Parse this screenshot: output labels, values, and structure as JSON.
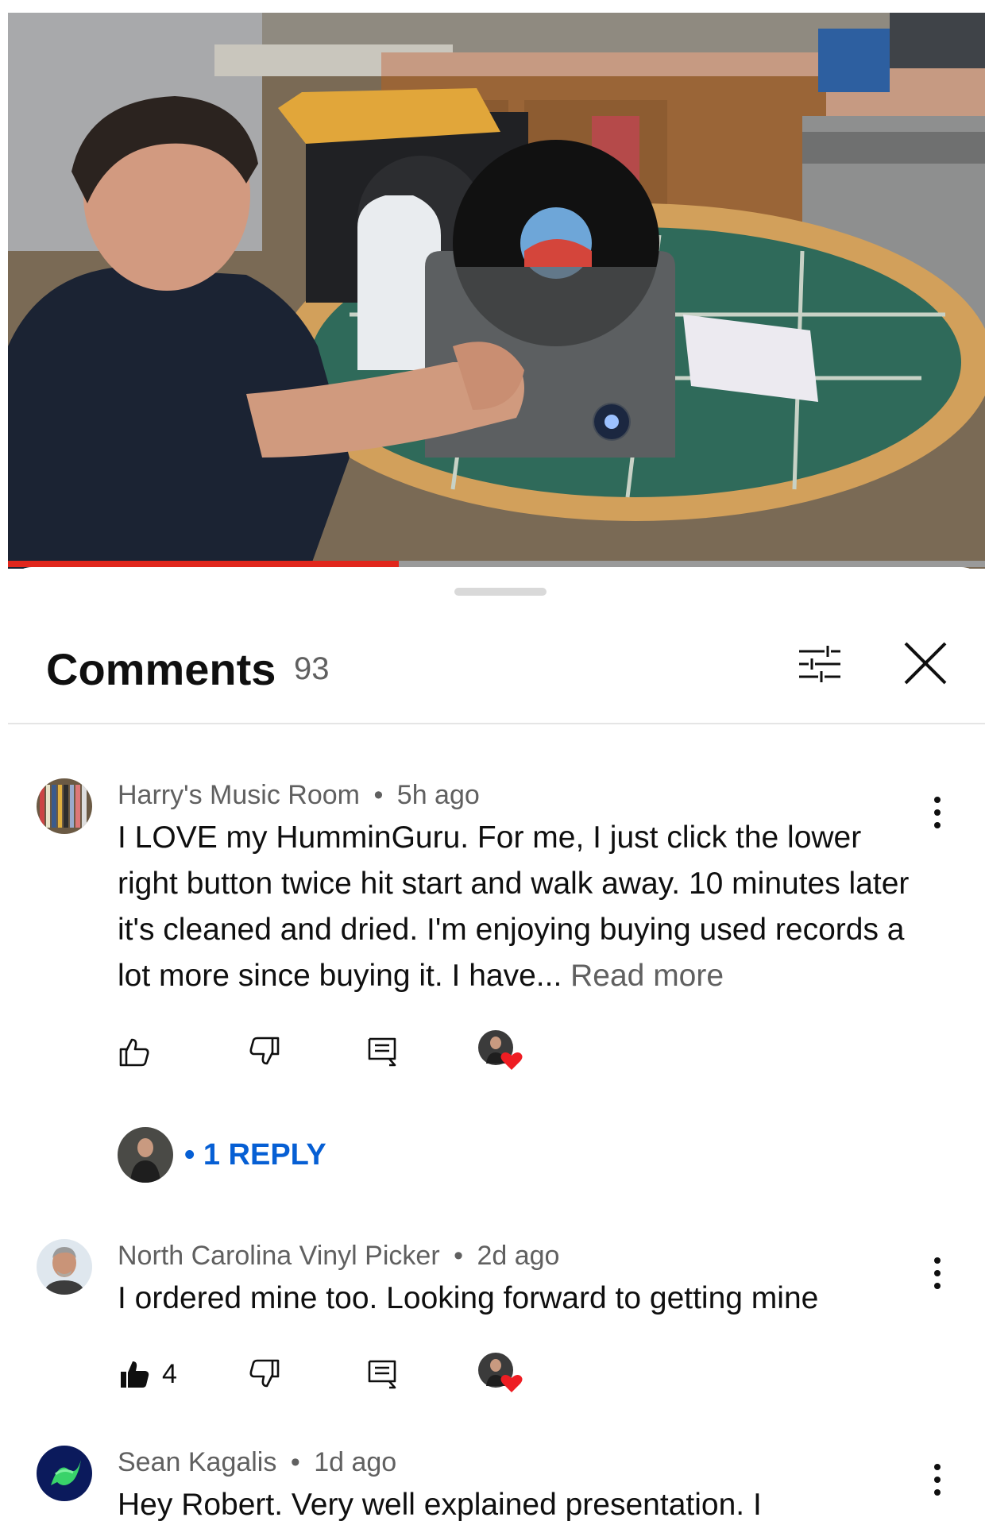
{
  "player": {
    "progress": 0.4
  },
  "sheet": {
    "title": "Comments",
    "count": "93",
    "filter_icon": "sliders-icon",
    "close_icon": "close-icon"
  },
  "comments": [
    {
      "author": "Harry's Music Room",
      "separator": "•",
      "time": "5h ago",
      "text": "I LOVE my HumminGuru. For me, I just click the lower right button twice hit start and walk away. 10 minutes later it's cleaned and dried. I'm enjoying buying used records a lot more since buying it.  I have...",
      "read_more": "Read more",
      "likes": "",
      "hearted": true,
      "replies": "• 1 REPLY"
    },
    {
      "author": "North Carolina Vinyl Picker",
      "separator": "•",
      "time": "2d ago",
      "text": "I ordered mine too.  Looking forward to getting mine",
      "likes": "4",
      "hearted": true
    },
    {
      "author": "Sean Kagalis",
      "separator": "•",
      "time": "1d ago",
      "text": "Hey Robert. Very well explained presentation. I"
    }
  ],
  "colors": {
    "accent_red": "#e0261c",
    "link_blue": "#065fd4",
    "secondary_text": "#606060"
  }
}
